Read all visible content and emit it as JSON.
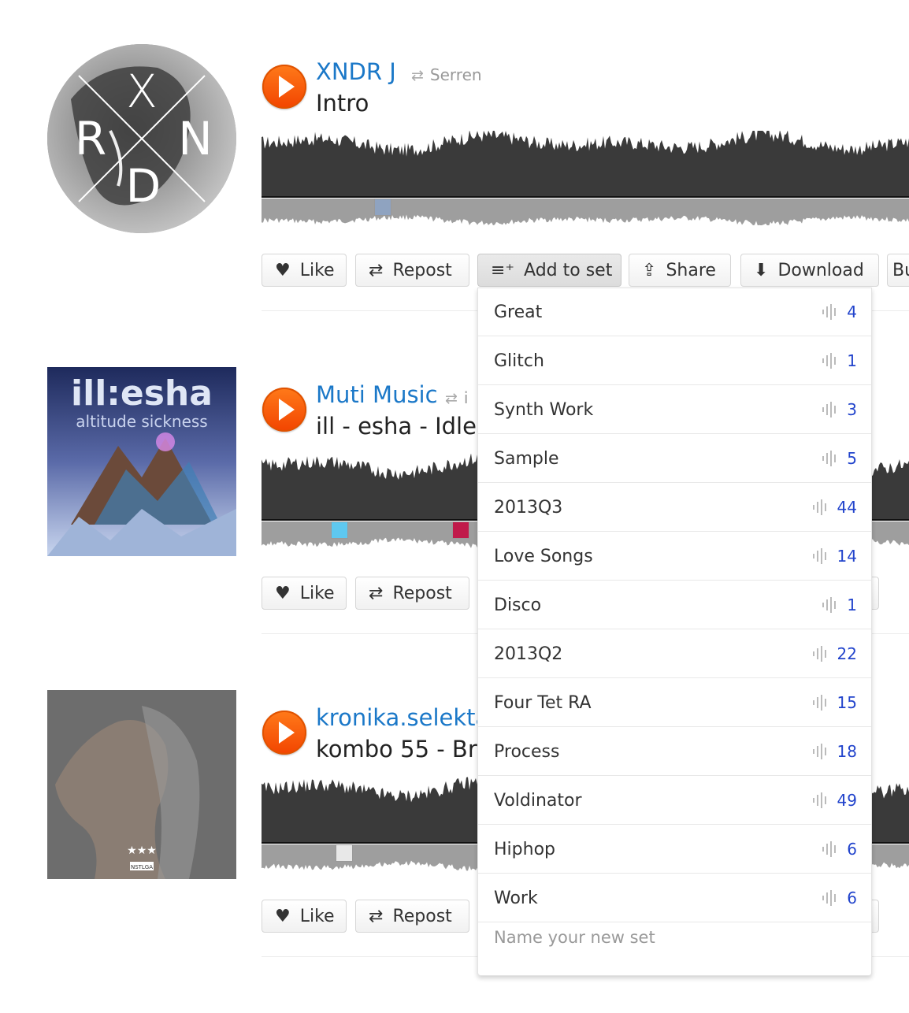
{
  "tracks": [
    {
      "username": "XNDR J",
      "reposter": "Serren",
      "title": "Intro",
      "artwork_letters": [
        "X",
        "R",
        "N",
        "D"
      ]
    },
    {
      "username": "Muti Music",
      "reposter": "i",
      "title": "ill - esha - Idle",
      "artwork_text": [
        "ill:esha",
        "altitude sickness"
      ]
    },
    {
      "username": "kronika.selekta",
      "reposter": "",
      "title": "kombo 55 - Br",
      "artwork_text": [
        "NSTLGA"
      ]
    }
  ],
  "actions": {
    "like": "Like",
    "repost": "Repost",
    "add_to_set": "Add to set",
    "share": "Share",
    "download": "Download",
    "more": "Bu"
  },
  "sets": [
    {
      "name": "Great",
      "count": "4"
    },
    {
      "name": "Glitch",
      "count": "1"
    },
    {
      "name": "Synth Work",
      "count": "3"
    },
    {
      "name": "Sample",
      "count": "5"
    },
    {
      "name": "2013Q3",
      "count": "44"
    },
    {
      "name": "Love Songs",
      "count": "14"
    },
    {
      "name": "Disco",
      "count": "1"
    },
    {
      "name": "2013Q2",
      "count": "22"
    },
    {
      "name": "Four Tet RA",
      "count": "15"
    },
    {
      "name": "Process",
      "count": "18"
    },
    {
      "name": "Voldinator",
      "count": "49"
    },
    {
      "name": "Hiphop",
      "count": "6"
    },
    {
      "name": "Work",
      "count": "6"
    }
  ],
  "new_set_placeholder": "Name your new set",
  "colors": {
    "accent": "#f24400",
    "link": "#1b78c8",
    "count": "#2244cc",
    "waveform": "#3a3a3a"
  }
}
